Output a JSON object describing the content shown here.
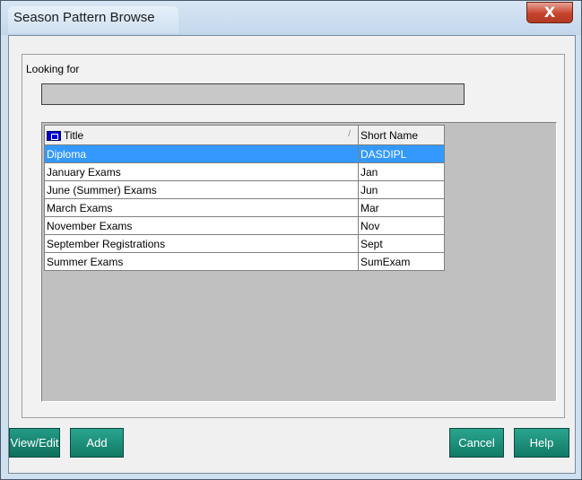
{
  "window": {
    "title": "Season Pattern Browse",
    "close_label": "X"
  },
  "search": {
    "label": "Looking for",
    "value": ""
  },
  "grid": {
    "columns": [
      "Title",
      "Short Name"
    ],
    "sort_indicator": "/",
    "rows": [
      {
        "title": "Diploma",
        "short": "DASDIPL",
        "selected": true
      },
      {
        "title": "January Exams",
        "short": "Jan",
        "selected": false
      },
      {
        "title": "June (Summer) Exams",
        "short": "Jun",
        "selected": false
      },
      {
        "title": "March Exams",
        "short": "Mar",
        "selected": false
      },
      {
        "title": "November Exams",
        "short": "Nov",
        "selected": false
      },
      {
        "title": "September Registrations",
        "short": "Sept",
        "selected": false
      },
      {
        "title": "Summer Exams",
        "short": "SumExam",
        "selected": false
      }
    ]
  },
  "buttons": {
    "view_edit": "View/Edit",
    "add": "Add",
    "cancel": "Cancel",
    "help": "Help"
  },
  "colors": {
    "selection": "#3399ff",
    "button": "#1a8f7a",
    "close": "#c7432c"
  }
}
